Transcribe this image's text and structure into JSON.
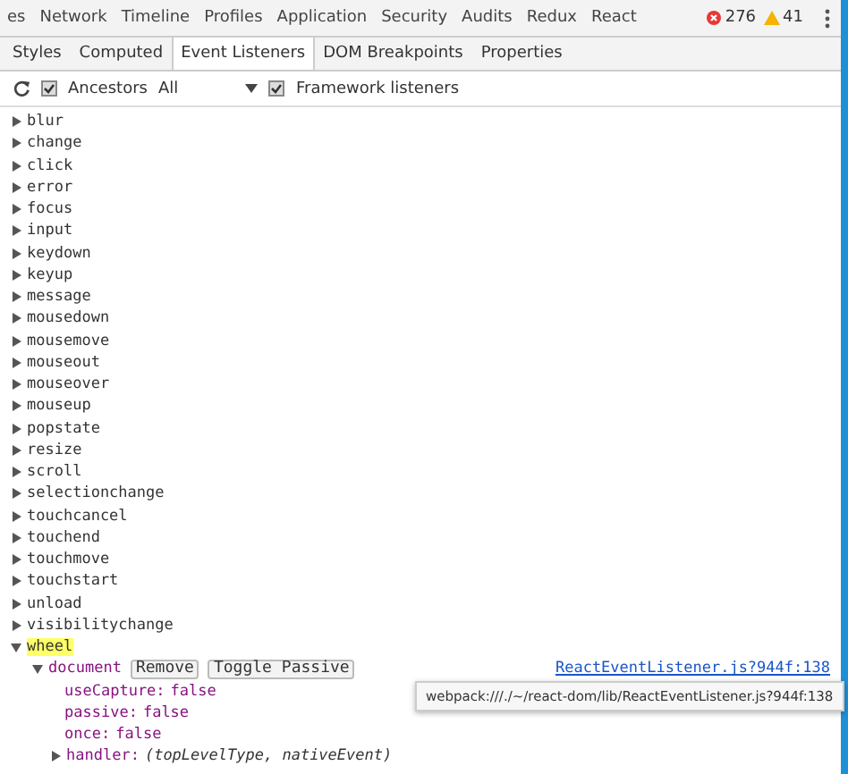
{
  "top_tabs": [
    {
      "label": "es",
      "selected": false
    },
    {
      "label": "Network",
      "selected": false
    },
    {
      "label": "Timeline",
      "selected": false
    },
    {
      "label": "Profiles",
      "selected": false
    },
    {
      "label": "Application",
      "selected": false
    },
    {
      "label": "Security",
      "selected": false
    },
    {
      "label": "Audits",
      "selected": false
    },
    {
      "label": "Redux",
      "selected": false
    },
    {
      "label": "React",
      "selected": false
    }
  ],
  "counters": {
    "errors": "276",
    "warnings": "41"
  },
  "sub_tabs": [
    {
      "label": "Styles",
      "selected": false
    },
    {
      "label": "Computed",
      "selected": false
    },
    {
      "label": "Event Listeners",
      "selected": true
    },
    {
      "label": "DOM Breakpoints",
      "selected": false
    },
    {
      "label": "Properties",
      "selected": false
    }
  ],
  "toolbar": {
    "ancestors": {
      "label": "Ancestors",
      "checked": true
    },
    "filter": {
      "value": "All"
    },
    "framework": {
      "label": "Framework listeners",
      "checked": true
    }
  },
  "events": [
    {
      "name": "blur",
      "expanded": false,
      "highlighted": false
    },
    {
      "name": "change",
      "expanded": false,
      "highlighted": false
    },
    {
      "name": "click",
      "expanded": false,
      "highlighted": false
    },
    {
      "name": "error",
      "expanded": false,
      "highlighted": false
    },
    {
      "name": "focus",
      "expanded": false,
      "highlighted": false
    },
    {
      "name": "input",
      "expanded": false,
      "highlighted": false
    },
    {
      "name": "keydown",
      "expanded": false,
      "highlighted": false
    },
    {
      "name": "keyup",
      "expanded": false,
      "highlighted": false
    },
    {
      "name": "message",
      "expanded": false,
      "highlighted": false
    },
    {
      "name": "mousedown",
      "expanded": false,
      "highlighted": false
    },
    {
      "name": "mousemove",
      "expanded": false,
      "highlighted": false
    },
    {
      "name": "mouseout",
      "expanded": false,
      "highlighted": false
    },
    {
      "name": "mouseover",
      "expanded": false,
      "highlighted": false
    },
    {
      "name": "mouseup",
      "expanded": false,
      "highlighted": false
    },
    {
      "name": "popstate",
      "expanded": false,
      "highlighted": false
    },
    {
      "name": "resize",
      "expanded": false,
      "highlighted": false
    },
    {
      "name": "scroll",
      "expanded": false,
      "highlighted": false
    },
    {
      "name": "selectionchange",
      "expanded": false,
      "highlighted": false
    },
    {
      "name": "touchcancel",
      "expanded": false,
      "highlighted": false
    },
    {
      "name": "touchend",
      "expanded": false,
      "highlighted": false
    },
    {
      "name": "touchmove",
      "expanded": false,
      "highlighted": false
    },
    {
      "name": "touchstart",
      "expanded": false,
      "highlighted": false
    },
    {
      "name": "unload",
      "expanded": false,
      "highlighted": false
    },
    {
      "name": "visibilitychange",
      "expanded": false,
      "highlighted": false
    },
    {
      "name": "wheel",
      "expanded": true,
      "highlighted": true,
      "children": [
        {
          "target": "document",
          "expanded": true,
          "buttons": [
            "Remove",
            "Toggle Passive"
          ],
          "link": "ReactEventListener.js?944f:138",
          "properties": [
            {
              "key": "useCapture:",
              "value": "false"
            },
            {
              "key": "passive:",
              "value": "false"
            },
            {
              "key": "once:",
              "value": "false"
            }
          ],
          "handler": {
            "key": "handler:",
            "value": "(topLevelType, nativeEvent)",
            "expanded": false
          }
        }
      ]
    }
  ],
  "tooltip": {
    "text": "webpack:///./~/react-dom/lib/ReactEventListener.js?944f:138"
  }
}
